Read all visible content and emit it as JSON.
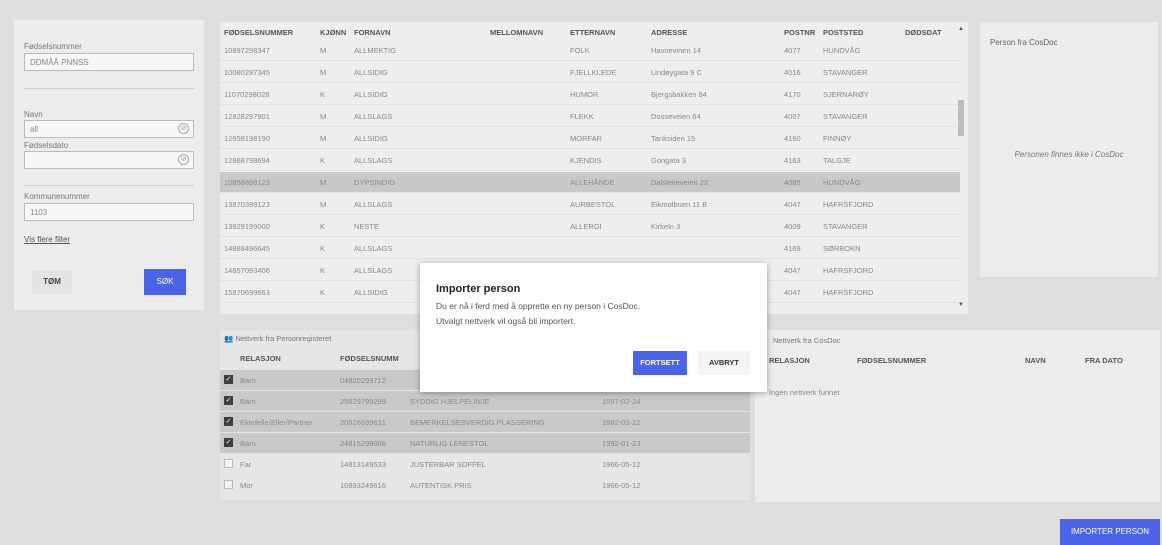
{
  "search": {
    "ssn_label": "Fødselsnummer",
    "ssn_placeholder": "DDMÅÅ PNNSS",
    "name_label": "Navn",
    "name_value": "all",
    "dob_label": "Fødselsdato",
    "dob_value": "",
    "municipality_label": "Kommunenummer",
    "municipality_value": "1103",
    "show_filters": "Vis flere filter",
    "clear_label": "TØM",
    "search_label": "SØK",
    "clear_icon": "⊘"
  },
  "person_table": {
    "headers": [
      "FØDSELSNUMMER",
      "KJØNN",
      "FORNAVN",
      "MELLOMNAVN",
      "ETTERNAVN",
      "ADRESSE",
      "POSTNR",
      "POSTSTED",
      "DØDSDAT"
    ],
    "rows": [
      [
        "10897298347",
        "M",
        "ALLMEKTIG",
        "",
        "FOLK",
        "Havnevinen 14",
        "4077",
        "HUNDVÅG"
      ],
      [
        "10080297345",
        "M",
        "ALLSIDIG",
        "",
        "FJELLKLEDE",
        "Lindøygata 9 C",
        "4016",
        "STAVANGER"
      ],
      [
        "11070298028",
        "K",
        "ALLSIDIG",
        "",
        "HUMOR",
        "Bjergsbakken 84",
        "4170",
        "SJERNARØY"
      ],
      [
        "12828297901",
        "M",
        "ALLSLAGS",
        "",
        "FLEKK",
        "Dosseveien 64",
        "4007",
        "STAVANGER"
      ],
      [
        "12658198190",
        "M",
        "ALLSIDIG",
        "",
        "MORFAR",
        "Tanksiden 15",
        "4160",
        "FINNØY"
      ],
      [
        "12868798694",
        "K",
        "ALLSLAGS",
        "",
        "KJENDIS",
        "Gongata 3",
        "4163",
        "TALGJE"
      ],
      [
        "10858899123",
        "M",
        "DYPSINDIG",
        "",
        "ALLEHÅNDE",
        "Dalsleiteveien 22",
        "4085",
        "HUNDVÅG"
      ],
      [
        "13870399123",
        "M",
        "ALLSLAGS",
        "",
        "AURBESTOL",
        "Eikmolbuen 11 B",
        "4047",
        "HAFRSFJORD"
      ],
      [
        "13829199000",
        "K",
        "NESTE",
        "",
        "ALLERGI",
        "Kirkeln 3",
        "4009",
        "STAVANGER"
      ],
      [
        "14888496645",
        "K",
        "ALLSLAGS",
        "",
        "",
        "",
        "4169",
        "SØRBOKN"
      ],
      [
        "14857093406",
        "K",
        "ALLSLAGS",
        "",
        "",
        "",
        "4047",
        "HAFRSFJORD"
      ],
      [
        "15870699663",
        "K",
        "ALLSIDIG",
        "",
        "",
        "",
        "4047",
        "HAFRSFJORD"
      ]
    ]
  },
  "cosdoc": {
    "title": "Person fra CosDoc",
    "empty_message": "Personen finnes ikke i CosDoc"
  },
  "network_left": {
    "title": "Nettverk fra Personregisteret",
    "icon": "👥",
    "headers": [
      "RELASJON",
      "FØDSELSNUMM"
    ],
    "rows": [
      {
        "checked": true,
        "relation": "Barn",
        "ssn": "04820299712",
        "name": "",
        "date": ""
      },
      {
        "checked": true,
        "relation": "Barn",
        "ssn": "25829799299",
        "name": "SYDDIG HJELPELINJE",
        "date": "1997-02-24"
      },
      {
        "checked": true,
        "relation": "Ektefelle/Eller/Partner",
        "ssn": "20826699631",
        "name": "BEMERKELSESVERDIG PLASSERING",
        "date": "1982-03-22"
      },
      {
        "checked": true,
        "relation": "Barn",
        "ssn": "24815299006",
        "name": "NATURLIG LENESTOL",
        "date": "1992-01-23"
      },
      {
        "checked": false,
        "relation": "Far",
        "ssn": "14813149533",
        "name": "JUSTERBAR SOFFEL",
        "date": "1966-05-12"
      },
      {
        "checked": false,
        "relation": "Mor",
        "ssn": "10893249616",
        "name": "AUTENTISK PRIS",
        "date": "1966-05-12"
      }
    ]
  },
  "network_right": {
    "title": "Nettverk fra CosDoc",
    "headers": [
      "RELASJON",
      "FØDSELSNUMMER",
      "NAVN",
      "FRA DATO"
    ],
    "empty_message": "Ingen nettverk funnet"
  },
  "import_button": "IMPORTER PERSON",
  "modal": {
    "title": "Importer person",
    "line1": "Du er nå i ferd med å opprette en ny person i CosDoc.",
    "line2": "Utvalgt nettverk vil også bli importert.",
    "continue_label": "FORTSETT",
    "cancel_label": "AVBRYT"
  },
  "colors": {
    "primary": "#4a63e8",
    "background": "#dedede",
    "selected_row": "#c8c8c8"
  }
}
